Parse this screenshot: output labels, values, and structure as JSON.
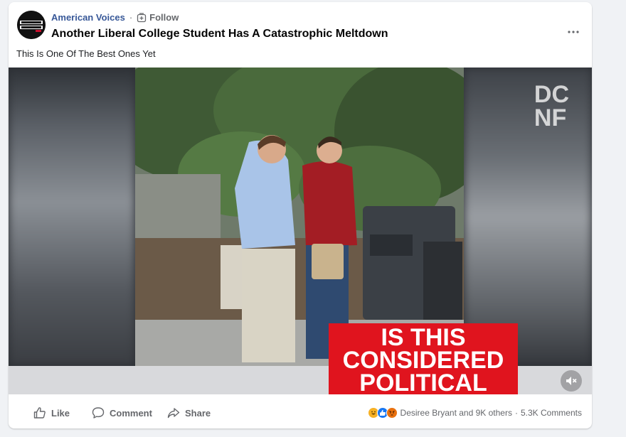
{
  "post": {
    "page_name": "American Voices",
    "avatar_text": "AMERICAN VOICES",
    "separator": "·",
    "follow_label": "Follow",
    "title": "Another Liberal College Student Has A Catastrophic Meltdown",
    "caption": "This Is One Of The Best Ones Yet"
  },
  "video": {
    "watermark_line1": "DC",
    "watermark_line2": "NF",
    "banner_lines": [
      "IS THIS",
      "CONSIDERED",
      "POLITICAL"
    ],
    "muted": true
  },
  "actions": {
    "like": "Like",
    "comment": "Comment",
    "share": "Share"
  },
  "stats": {
    "reactions": [
      "haha",
      "like",
      "angry"
    ],
    "reactors": "Desiree Bryant and 9K others",
    "separator": "·",
    "comments": "5.3K Comments"
  },
  "colors": {
    "link": "#385898",
    "secondary_text": "#65676b",
    "banner": "#e0141e",
    "like_blue": "#1877f2",
    "haha_yellow": "#f7b125",
    "angry_orange": "#e9710f"
  }
}
